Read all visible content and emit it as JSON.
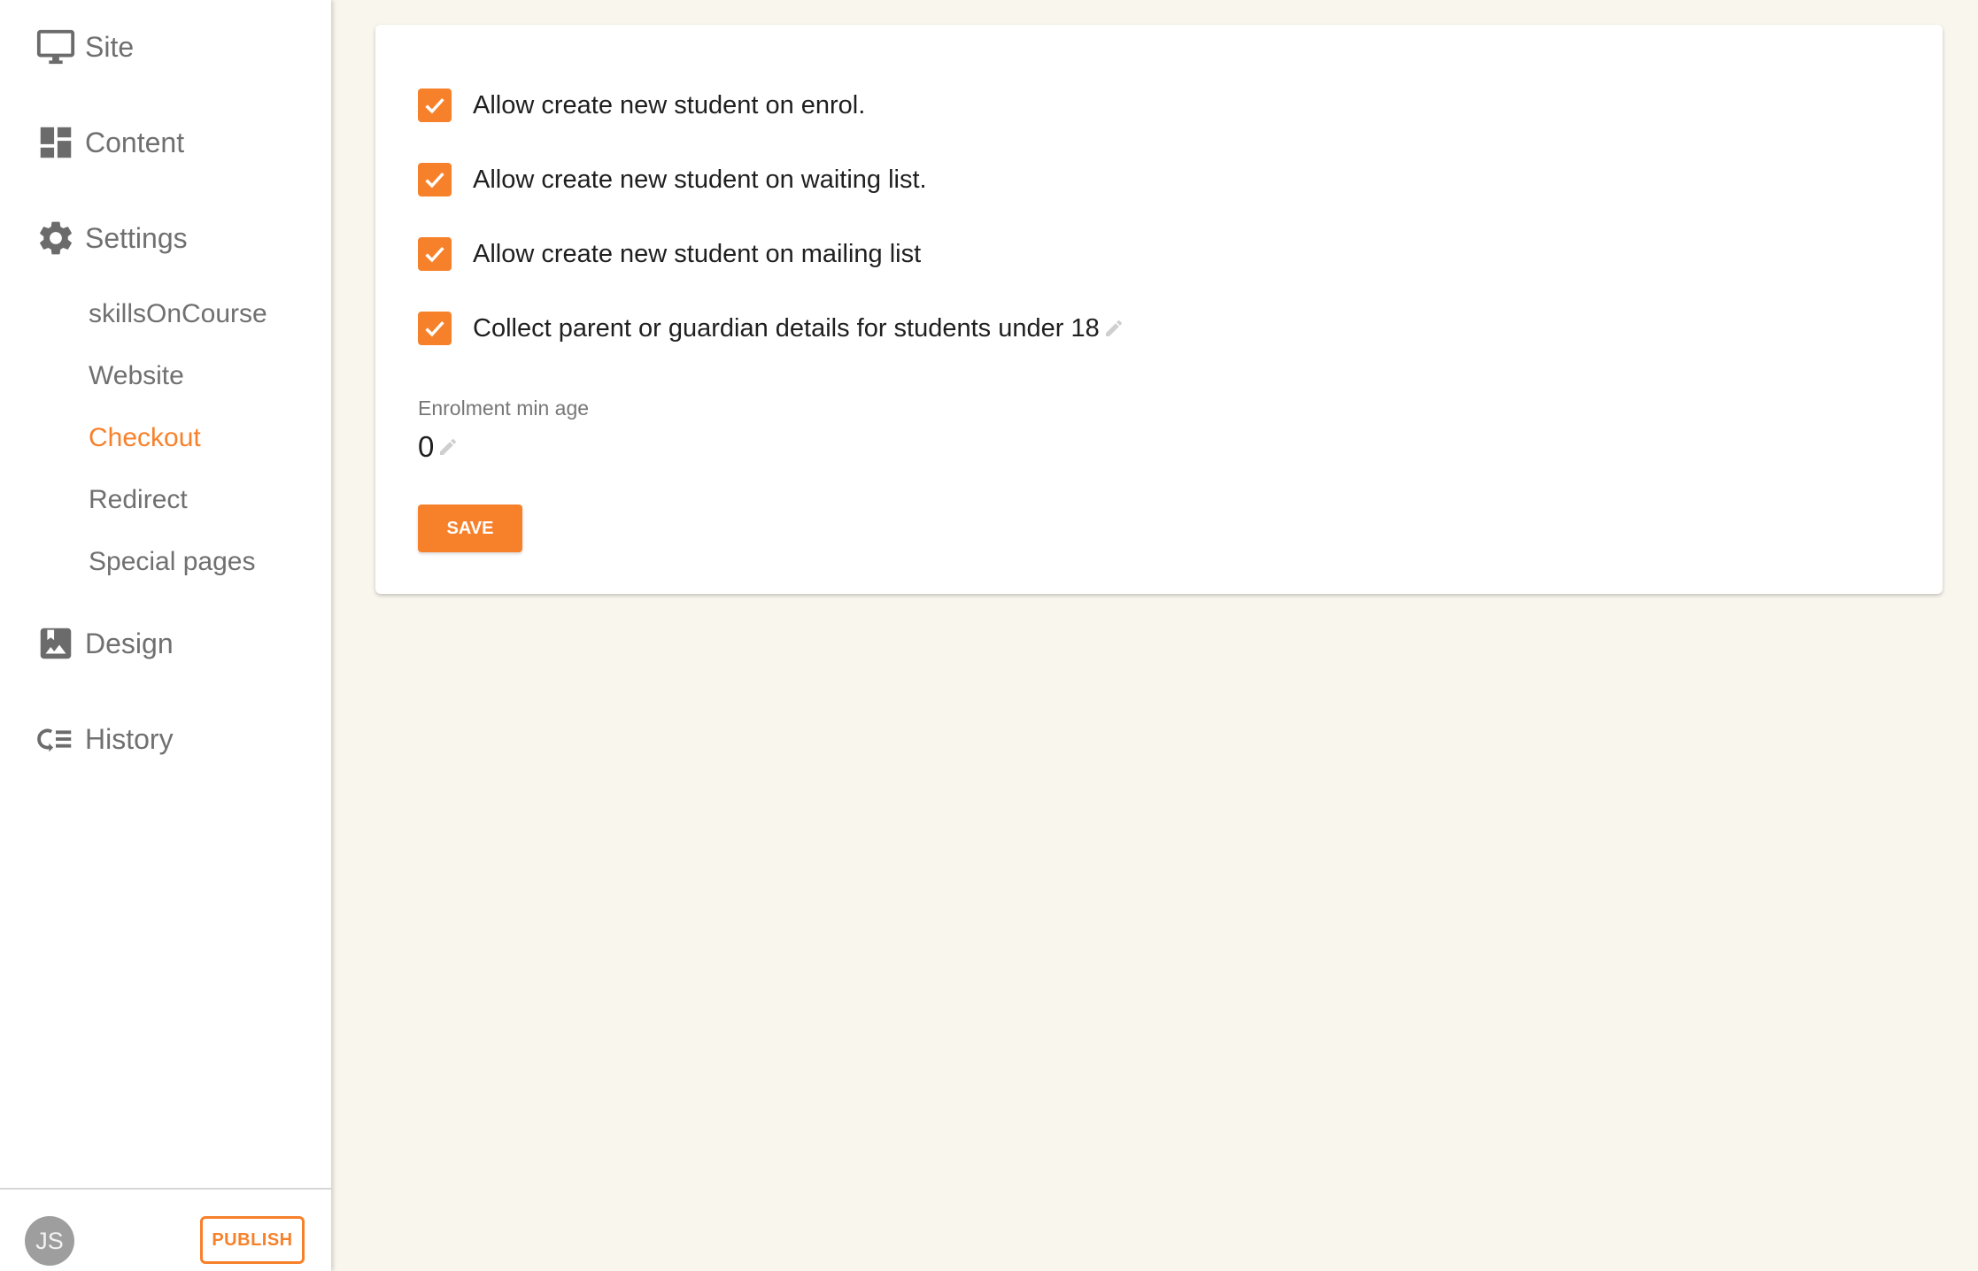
{
  "sidebar": {
    "nav": [
      {
        "label": "Site",
        "icon": "monitor-icon"
      },
      {
        "label": "Content",
        "icon": "dashboard-icon"
      },
      {
        "label": "Settings",
        "icon": "gear-icon"
      },
      {
        "label": "Design",
        "icon": "image-icon"
      },
      {
        "label": "History",
        "icon": "history-icon"
      }
    ],
    "settings_sub": [
      {
        "label": "skillsOnCourse",
        "active": false
      },
      {
        "label": "Website",
        "active": false
      },
      {
        "label": "Checkout",
        "active": true
      },
      {
        "label": "Redirect",
        "active": false
      },
      {
        "label": "Special pages",
        "active": false
      }
    ],
    "footer": {
      "avatar_initials": "JS",
      "publish_label": "PUBLISH"
    }
  },
  "main": {
    "checkboxes": [
      {
        "label": "Allow create new student on enrol.",
        "checked": true
      },
      {
        "label": "Allow create new student on waiting list.",
        "checked": true
      },
      {
        "label": "Allow create new student on mailing list",
        "checked": true
      },
      {
        "label": "Collect parent or guardian details for students under 18",
        "checked": true
      }
    ],
    "min_age": {
      "label": "Enrolment min age",
      "value": "0"
    },
    "save_label": "SAVE"
  },
  "colors": {
    "accent": "#f7812b",
    "background": "#f9f7ed",
    "sidebar": "#ffffff"
  }
}
